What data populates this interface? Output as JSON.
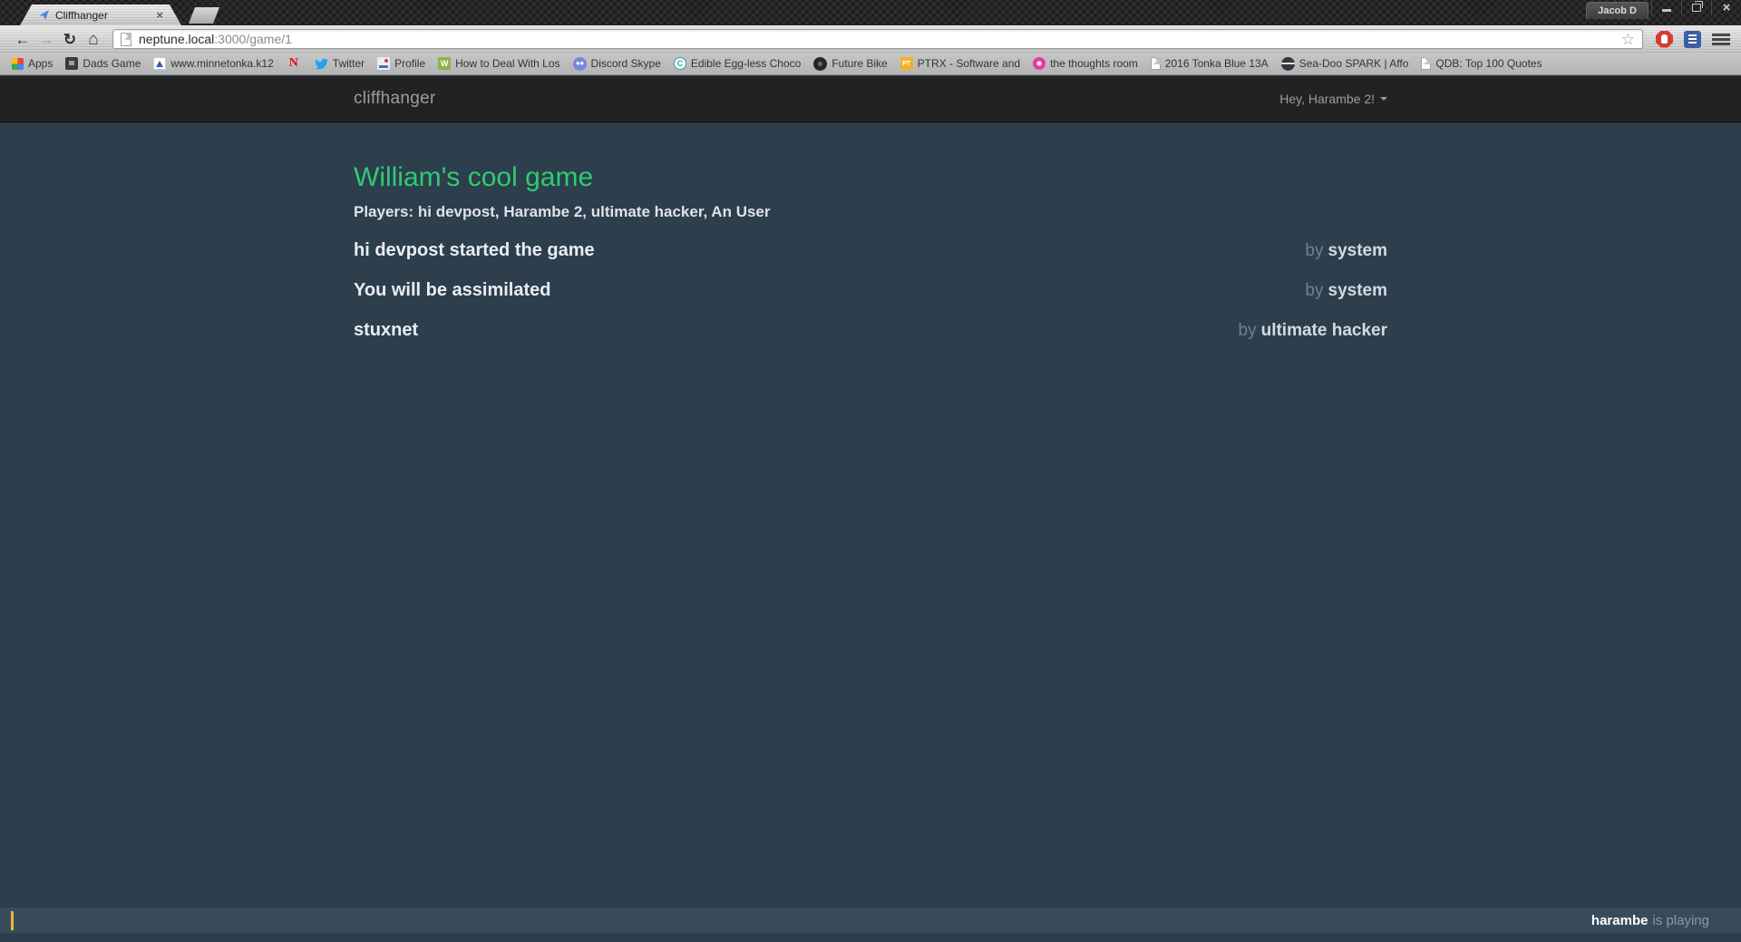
{
  "colors": {
    "accent_green": "#2ecc71",
    "page_bg": "#2d3e4d",
    "navbar_bg": "#222222",
    "input_bar_bg": "#384b5b",
    "caret_yellow": "#e6b83c"
  },
  "browser": {
    "profile_label": "Jacob D",
    "tab_title": "Cliffhanger",
    "url": {
      "host": "neptune.local",
      "rest": ":3000/game/1"
    },
    "bookmarks": [
      {
        "label": "Apps"
      },
      {
        "label": "Dads Game"
      },
      {
        "label": "www.minnetonka.k12"
      },
      {
        "label": "",
        "icon_text": "N"
      },
      {
        "label": "Twitter"
      },
      {
        "label": "Profile"
      },
      {
        "label": "How to Deal With Los",
        "icon_text": "W"
      },
      {
        "label": "Discord Skype"
      },
      {
        "label": "Edible Egg-less Choco",
        "icon_text": "C"
      },
      {
        "label": "Future Bike"
      },
      {
        "label": "PTRX - Software and",
        "icon_text": "PT"
      },
      {
        "label": "the thoughts room"
      },
      {
        "label": "2016 Tonka Blue 13A"
      },
      {
        "label": "Sea-Doo SPARK | Affo"
      },
      {
        "label": "QDB: Top 100 Quotes"
      }
    ]
  },
  "page": {
    "navbar": {
      "brand": "cliffhanger",
      "user_menu": "Hey, Harambe 2!"
    },
    "game": {
      "title": "William's cool game",
      "players": "Players: hi devpost, Harambe 2, ultimate hacker, An User"
    },
    "messages": [
      {
        "text": "hi devpost started the game",
        "by_label": "by",
        "author": "system"
      },
      {
        "text": "You will be assimilated",
        "by_label": "by",
        "author": "system"
      },
      {
        "text": "stuxnet",
        "by_label": "by",
        "author": "ultimate hacker"
      }
    ],
    "status": {
      "user": "harambe",
      "rest": "is playing"
    }
  }
}
